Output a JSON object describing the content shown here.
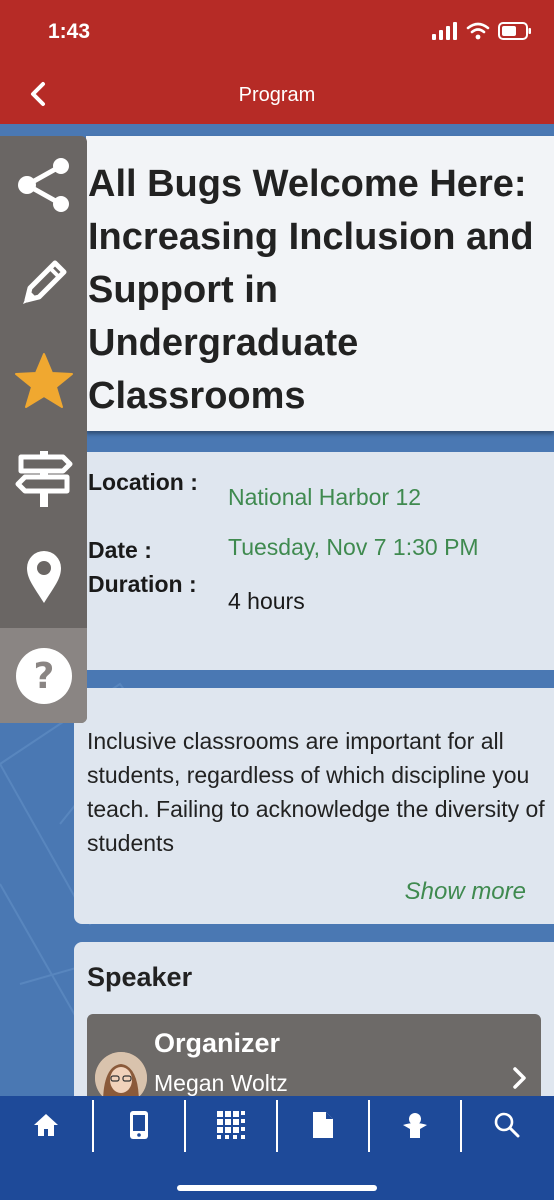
{
  "status": {
    "time": "1:43"
  },
  "nav": {
    "title": "Program"
  },
  "session": {
    "title": "All Bugs Welcome Here: Increasing Inclusion and Support in Undergraduate Classrooms",
    "location_label": "Location :",
    "location_value": "National Harbor 12",
    "date_label": "Date :",
    "date_value": "Tuesday, Nov 7 1:30 PM",
    "duration_label": "Duration :",
    "duration_value": "4 hours",
    "description": "Inclusive classrooms are important for all students, regardless of which discipline you teach. Failing to acknowledge the diversity of students",
    "show_more": "Show more"
  },
  "speaker": {
    "heading": "Speaker",
    "role": "Organizer",
    "name": "Megan Woltz"
  },
  "side_toolbar": {
    "items": [
      "share-icon",
      "pencil-icon",
      "star-icon",
      "signpost-icon",
      "map-pin-icon",
      "help-icon"
    ]
  },
  "tabbar": {
    "items": [
      "home-icon",
      "phone-icon",
      "grid-icon",
      "document-icon",
      "person-icon",
      "search-icon"
    ]
  },
  "colors": {
    "header_red": "#b62b26",
    "tabbar_blue": "#1e4a99",
    "value_green": "#3f8a4f",
    "star_gold": "#f0a830",
    "toolbar_gray": "#6a6664"
  }
}
